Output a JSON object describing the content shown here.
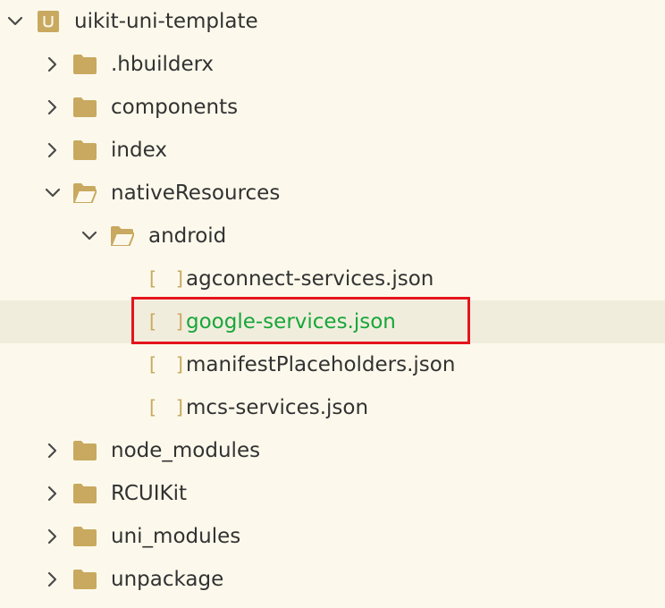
{
  "tree": {
    "project": {
      "label": "uikit-uni-template",
      "expanded": true
    },
    "items": [
      {
        "label": ".hbuilderx",
        "type": "folder",
        "expanded": false
      },
      {
        "label": "components",
        "type": "folder",
        "expanded": false
      },
      {
        "label": "index",
        "type": "folder",
        "expanded": false
      },
      {
        "label": "nativeResources",
        "type": "folder",
        "expanded": true
      },
      {
        "label": "android",
        "type": "folder",
        "expanded": true
      },
      {
        "label": "agconnect-services.json",
        "type": "json-file"
      },
      {
        "label": "google-services.json",
        "type": "json-file",
        "selected": true
      },
      {
        "label": "manifestPlaceholders.json",
        "type": "json-file"
      },
      {
        "label": "mcs-services.json",
        "type": "json-file"
      },
      {
        "label": "node_modules",
        "type": "folder",
        "expanded": false
      },
      {
        "label": "RCUIKit",
        "type": "folder",
        "expanded": false
      },
      {
        "label": "uni_modules",
        "type": "folder",
        "expanded": false
      },
      {
        "label": "unpackage",
        "type": "folder",
        "expanded": false
      }
    ],
    "json_icon_glyph": "[ ]"
  },
  "colors": {
    "background": "#fcf9ec",
    "selected_row": "#f1eddd",
    "folder": "#c9a95f",
    "text": "#323232",
    "selected_text": "#17a63a",
    "highlight_border": "#e4141c"
  }
}
